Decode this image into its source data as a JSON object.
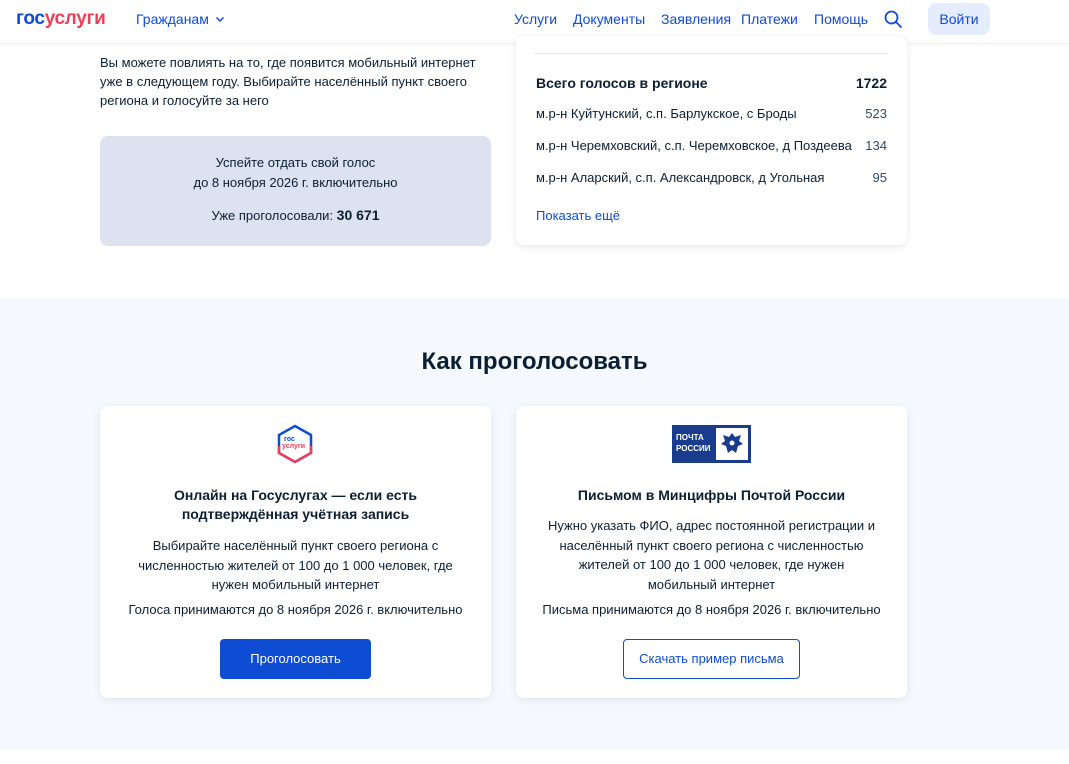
{
  "header": {
    "logo_gos": "гос",
    "logo_uslugi": "услуги",
    "citizens": "Гражданам",
    "nav": [
      "Услуги",
      "Документы",
      "Заявления",
      "Платежи",
      "Помощь"
    ],
    "login": "Войти"
  },
  "intro": {
    "text": "Вы можете повлиять на то, где появится мобильный интернет уже в следующем году. Выбирайте населённый пункт своего региона и голосуйте за него"
  },
  "deadline": {
    "line1": "Успейте отдать свой голос",
    "line2": "до 8 ноября 2026 г. включительно",
    "voted_label": "Уже проголосовали: ",
    "voted_count": "30 671"
  },
  "votes": {
    "total_label": "Всего голосов в регионе",
    "total_value": "1722",
    "rows": [
      {
        "place": "м.р-н Куйтунский, с.п. Барлукское, с Броды",
        "count": "523"
      },
      {
        "place": "м.р-н Черемховский, с.п. Черемховское, д Поздеева",
        "count": "134"
      },
      {
        "place": "м.р-н Аларский, с.п. Александровск, д Угольная",
        "count": "95"
      }
    ],
    "show_more": "Показать ещё"
  },
  "how_to_vote": {
    "title": "Как проголосовать",
    "online": {
      "logo_top": "гос",
      "logo_bottom": "услуги",
      "title": "Онлайн на Госуслугах — если есть подтверждённая учётная запись",
      "text": "Выбирайте населённый пункт своего региона с численностью жителей от 100 до 1 000 человек, где нужен мобильный интернет",
      "deadline": "Голоса принимаются до 8 ноября 2026 г. включительно",
      "button": "Проголосовать"
    },
    "mail": {
      "logo_text": "ПОЧТА РОССИИ",
      "title": "Письмом в Минцифры Почтой России",
      "text": "Нужно указать ФИО, адрес постоянной регистрации и населённый пункт своего региона с численностью жителей от 100 до 1 000 человек, где нужен мобильный интернет",
      "deadline": "Письма принимаются до 8 ноября 2026 г. включительно",
      "button": "Скачать пример письма"
    }
  },
  "colors": {
    "brand_blue": "#0d4cd3",
    "brand_red": "#ee3f58",
    "deadline_bg": "#dce2ef",
    "section_bg": "#f5f8fc",
    "post_blue": "#1a3c8c"
  },
  "icons": [
    "chevron-down-icon",
    "search-icon",
    "gosuslugi-logo",
    "russian-post-logo"
  ]
}
